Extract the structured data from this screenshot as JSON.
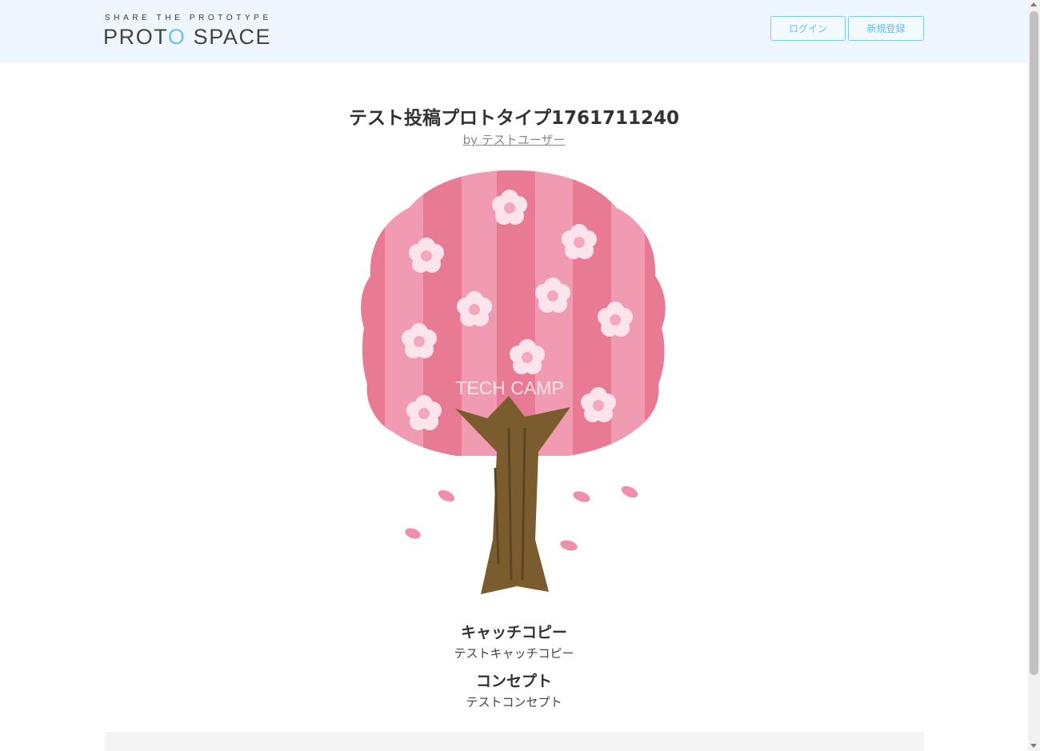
{
  "header": {
    "logo_tagline": "SHARE THE PROTOTYPE",
    "logo_name_part1": "PROT",
    "logo_name_accent": "O",
    "logo_name_part2": " SPACE",
    "login_label": "ログイン",
    "signup_label": "新規登録"
  },
  "prototype": {
    "title": "テスト投稿プロトタイプ1761711240",
    "byline_prefix": "by ",
    "author": "テストユーザー",
    "image_watermark": "TECH CAMP",
    "catch_copy_heading": "キャッチコピー",
    "catch_copy": "テストキャッチコピー",
    "concept_heading": "コンセプト",
    "concept": "テストコンセプト"
  },
  "icons": {
    "image": "cherry-blossom-tree-illustration"
  },
  "colors": {
    "header_bg": "#eef7fd",
    "accent": "#6cc3ea",
    "button_border": "#7fcbee"
  }
}
